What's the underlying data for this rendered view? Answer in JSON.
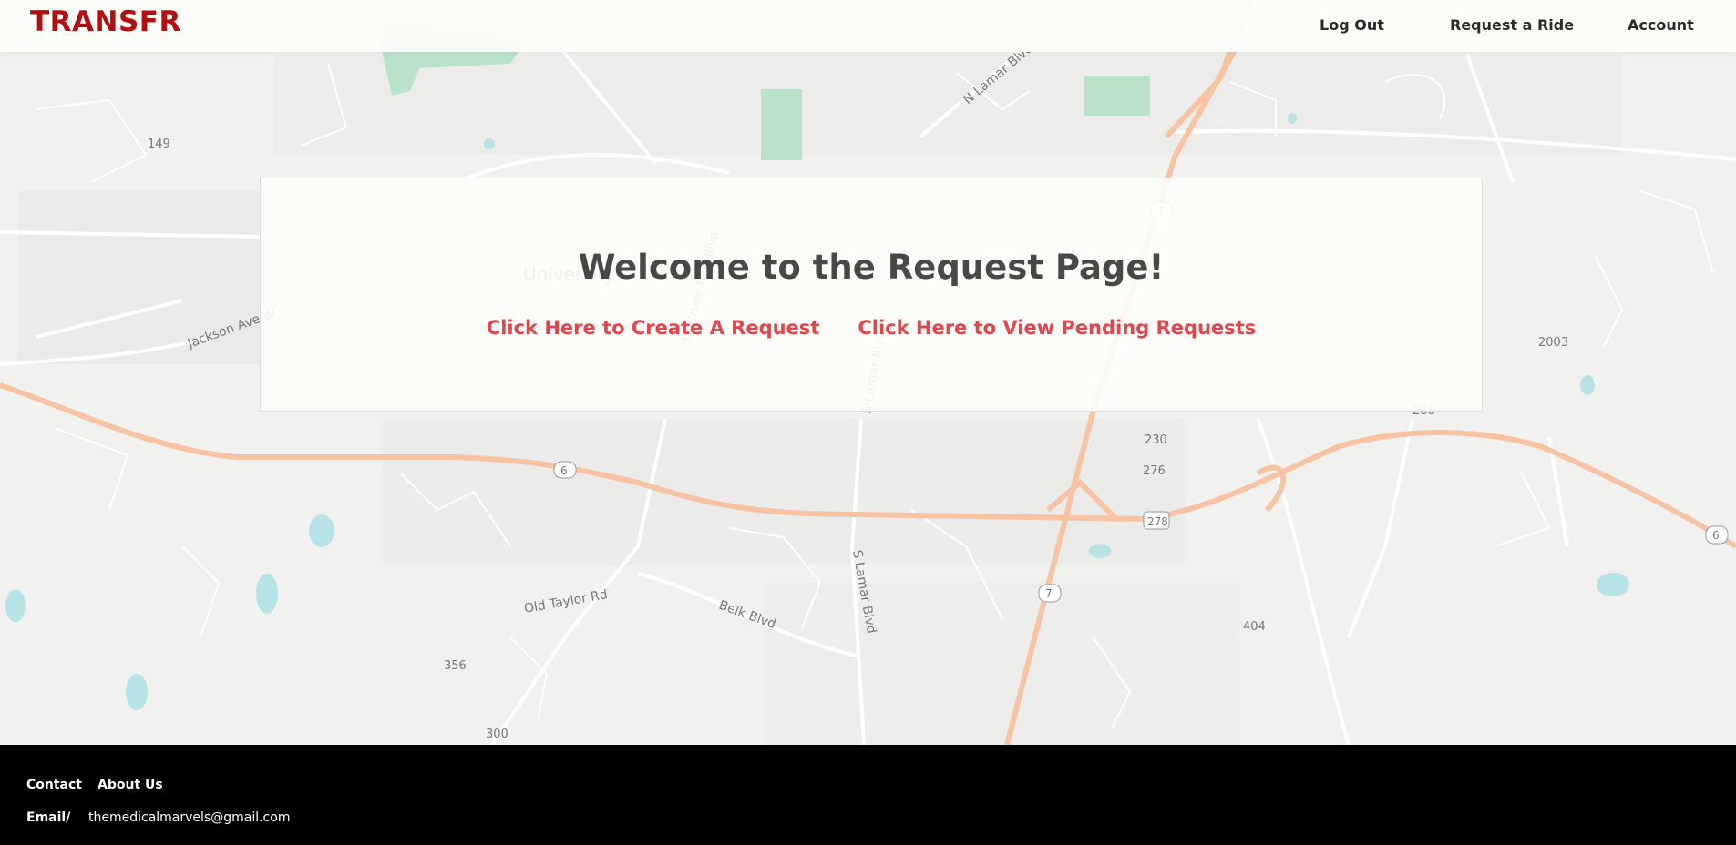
{
  "brand": {
    "logo_text": "TRANSFR",
    "color": "#b30e10"
  },
  "nav": {
    "items": [
      {
        "label": "Log Out"
      },
      {
        "label": "Request a Ride"
      },
      {
        "label": "Account"
      }
    ]
  },
  "main": {
    "title": "Welcome to the Request Page!",
    "create_request_label": "Click Here to Create A Request",
    "view_pending_label": "Click Here to View Pending Requests",
    "link_color": "#e0474c"
  },
  "map": {
    "labels": {
      "university": "University",
      "jackson": "Jackson Ave W",
      "n_lamar": "N Lamar Blvd",
      "s_lamar_top": "S Lamar Blvd",
      "s_lamar_bottom": "S Lamar Blvd",
      "old_taylor": "Old Taylor Rd",
      "belk": "Belk Blvd",
      "gertrude": "Gertrude Ford Blvd"
    },
    "route_numbers": [
      "149",
      "2003",
      "6",
      "230",
      "276",
      "278",
      "7",
      "404",
      "356",
      "300",
      "7",
      "6",
      "288"
    ]
  },
  "footer": {
    "contact_label": "Contact",
    "about_label": "About Us",
    "email_label": "Email/",
    "email_value": "themedicalmarvels@gmail.com"
  }
}
